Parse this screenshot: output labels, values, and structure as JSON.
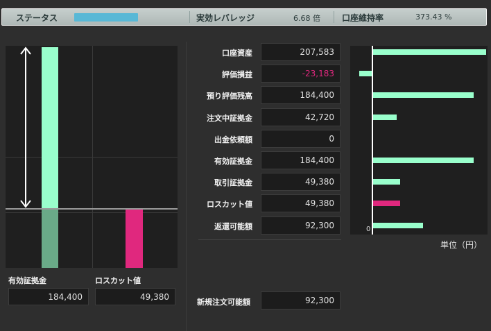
{
  "status": {
    "label": "ステータス",
    "leverage_label": "実効レバレッジ",
    "leverage_value": "6.68 倍",
    "margin_rate_label": "口座維持率",
    "margin_rate_value": "373.43 %"
  },
  "rows": [
    {
      "label": "口座資産",
      "value": "207,583",
      "negative": false
    },
    {
      "label": "評価損益",
      "value": "-23,183",
      "negative": true
    },
    {
      "label": "預り評価残高",
      "value": "184,400",
      "negative": false
    },
    {
      "label": "注文中証拠金",
      "value": "42,720",
      "negative": false
    },
    {
      "label": "出金依頼額",
      "value": "0",
      "negative": false
    },
    {
      "label": "有効証拠金",
      "value": "184,400",
      "negative": false
    },
    {
      "label": "取引証拠金",
      "value": "49,380",
      "negative": false
    },
    {
      "label": "ロスカット値",
      "value": "49,380",
      "negative": false
    },
    {
      "label": "返還可能額",
      "value": "92,300",
      "negative": false
    }
  ],
  "new_order": {
    "label": "新規注文可能額",
    "value": "92,300"
  },
  "left_chart": {
    "effective_margin_label": "有効証拠金",
    "effective_margin_value": "184,400",
    "losscut_label": "ロスカット値",
    "losscut_value": "49,380"
  },
  "bar_chart": {
    "zero_label": "0",
    "unit_label": "単位（円）",
    "bars": [
      {
        "value": 207583,
        "color": "#99ffcc"
      },
      {
        "value": -23183,
        "color": "#99ffcc"
      },
      {
        "value": 184400,
        "color": "#99ffcc"
      },
      {
        "value": 42720,
        "color": "#99ffcc"
      },
      {
        "value": 0,
        "color": "#99ffcc"
      },
      {
        "value": 184400,
        "color": "#99ffcc"
      },
      {
        "value": 49380,
        "color": "#99ffcc"
      },
      {
        "value": 49380,
        "color": "#e0287e"
      },
      {
        "value": 92300,
        "color": "#99ffcc"
      }
    ],
    "max_value": 207583
  },
  "colors": {
    "accent_green": "#99ffcc",
    "dark_green": "#6aaa88",
    "losscut_pink": "#e0287e",
    "negative_text": "#e0287e",
    "status_meter": "#58b8d6"
  }
}
